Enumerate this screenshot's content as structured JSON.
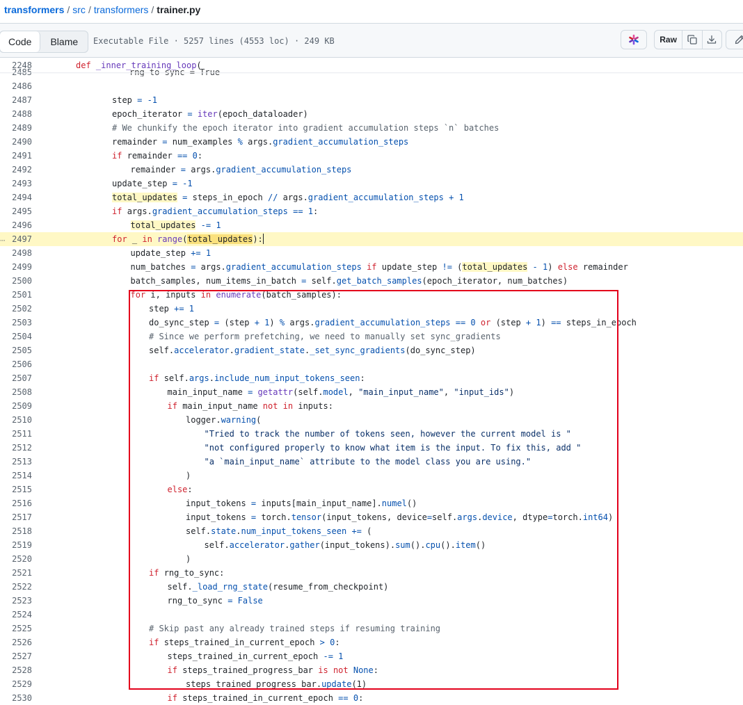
{
  "breadcrumb": {
    "repo": "transformers",
    "sep": "/",
    "dir1": "src",
    "dir2": "transformers",
    "file": "trainer.py"
  },
  "toolbar": {
    "code_label": "Code",
    "blame_label": "Blame",
    "file_info": "Executable File · 5257 lines (4553 loc) · 249 KB",
    "raw_label": "Raw",
    "icons": {
      "copilot": "copilot-icon",
      "copy": "copy-icon",
      "download": "download-icon",
      "edit": "pencil-icon"
    }
  },
  "sticky": {
    "line_number": "2248",
    "kw": "def",
    "fn": "_inner_training_loop",
    "rest": "("
  },
  "ghost": {
    "line_number": "2485",
    "text": "rng_to_sync = True"
  },
  "colors": {
    "keyword": "#cf222e",
    "function": "#6639ba",
    "name": "#0550ae",
    "string": "#0a3069",
    "comment": "#59636e",
    "highlight": "#fff8c5",
    "box": "#e3001b"
  },
  "lines": [
    {
      "n": "2486",
      "i": 0,
      "t": []
    },
    {
      "n": "2487",
      "i": 2,
      "t": [
        [
          "",
          "step "
        ],
        [
          "n",
          "= -1"
        ]
      ]
    },
    {
      "n": "2488",
      "i": 2,
      "t": [
        [
          "",
          "epoch_iterator "
        ],
        [
          "n",
          "= "
        ],
        [
          "f",
          "iter"
        ],
        [
          "",
          "(epoch_dataloader)"
        ]
      ]
    },
    {
      "n": "2489",
      "i": 2,
      "t": [
        [
          "c",
          "# We chunkify the epoch iterator into gradient accumulation steps `n` batches"
        ]
      ]
    },
    {
      "n": "2490",
      "i": 2,
      "t": [
        [
          "",
          "remainder "
        ],
        [
          "n",
          "= "
        ],
        [
          "",
          "num_examples "
        ],
        [
          "n",
          "% "
        ],
        [
          "",
          "args."
        ],
        [
          "n",
          "gradient_accumulation_steps"
        ]
      ]
    },
    {
      "n": "2491",
      "i": 2,
      "t": [
        [
          "k",
          "if "
        ],
        [
          "",
          "remainder "
        ],
        [
          "n",
          "== 0"
        ],
        [
          "",
          ":"
        ]
      ]
    },
    {
      "n": "2492",
      "i": 3,
      "t": [
        [
          "",
          "remainder "
        ],
        [
          "n",
          "= "
        ],
        [
          "",
          "args."
        ],
        [
          "n",
          "gradient_accumulation_steps"
        ]
      ]
    },
    {
      "n": "2493",
      "i": 2,
      "t": [
        [
          "",
          "update_step "
        ],
        [
          "n",
          "= -1"
        ]
      ]
    },
    {
      "n": "2494",
      "i": 2,
      "t": [
        [
          "m",
          "total_updates"
        ],
        [
          "",
          " "
        ],
        [
          "n",
          "= "
        ],
        [
          "",
          "steps_in_epoch "
        ],
        [
          "n",
          "// "
        ],
        [
          "",
          "args."
        ],
        [
          "n",
          "gradient_accumulation_steps + 1"
        ]
      ]
    },
    {
      "n": "2495",
      "i": 2,
      "t": [
        [
          "k",
          "if "
        ],
        [
          "",
          "args."
        ],
        [
          "n",
          "gradient_accumulation_steps == 1"
        ],
        [
          "",
          ":"
        ]
      ]
    },
    {
      "n": "2496",
      "i": 3,
      "t": [
        [
          "m",
          "total_updates"
        ],
        [
          "",
          " "
        ],
        [
          "n",
          "-= 1"
        ]
      ]
    },
    {
      "n": "2497",
      "i": 2,
      "hl": true,
      "cursor": true,
      "t": [
        [
          "k",
          "for "
        ],
        [
          "",
          "_ "
        ],
        [
          "k",
          "in "
        ],
        [
          "f",
          "range"
        ],
        [
          "",
          "("
        ],
        [
          "m",
          "total_updates"
        ],
        [
          "",
          "):"
        ]
      ]
    },
    {
      "n": "2498",
      "i": 3,
      "t": [
        [
          "",
          "update_step "
        ],
        [
          "n",
          "+= 1"
        ]
      ]
    },
    {
      "n": "2499",
      "i": 3,
      "t": [
        [
          "",
          "num_batches "
        ],
        [
          "n",
          "= "
        ],
        [
          "",
          "args."
        ],
        [
          "n",
          "gradient_accumulation_steps "
        ],
        [
          "k",
          "if "
        ],
        [
          "",
          "update_step "
        ],
        [
          "n",
          "!= "
        ],
        [
          "",
          "("
        ],
        [
          "m",
          "total_updates"
        ],
        [
          "",
          " "
        ],
        [
          "n",
          "- 1"
        ],
        [
          "",
          ") "
        ],
        [
          "k",
          "else "
        ],
        [
          "",
          "remainder"
        ]
      ]
    },
    {
      "n": "2500",
      "i": 3,
      "t": [
        [
          "",
          "batch_samples, num_items_in_batch "
        ],
        [
          "n",
          "= "
        ],
        [
          "",
          "self."
        ],
        [
          "n",
          "get_batch_samples"
        ],
        [
          "",
          "(epoch_iterator, num_batches)"
        ]
      ]
    },
    {
      "n": "2501",
      "i": 3,
      "t": [
        [
          "k",
          "for "
        ],
        [
          "",
          "i, inputs "
        ],
        [
          "k",
          "in "
        ],
        [
          "f",
          "enumerate"
        ],
        [
          "",
          "(batch_samples):"
        ]
      ]
    },
    {
      "n": "2502",
      "i": 4,
      "t": [
        [
          "",
          "step "
        ],
        [
          "n",
          "+= 1"
        ]
      ]
    },
    {
      "n": "2503",
      "i": 4,
      "t": [
        [
          "",
          "do_sync_step "
        ],
        [
          "n",
          "= "
        ],
        [
          "",
          "(step "
        ],
        [
          "n",
          "+ 1"
        ],
        [
          "",
          ") "
        ],
        [
          "n",
          "% "
        ],
        [
          "",
          "args."
        ],
        [
          "n",
          "gradient_accumulation_steps == 0 "
        ],
        [
          "k",
          "or "
        ],
        [
          "",
          "(step "
        ],
        [
          "n",
          "+ 1"
        ],
        [
          "",
          ") "
        ],
        [
          "n",
          "== "
        ],
        [
          "",
          "steps_in_epoch"
        ]
      ]
    },
    {
      "n": "2504",
      "i": 4,
      "t": [
        [
          "c",
          "# Since we perform prefetching, we need to manually set sync_gradients"
        ]
      ]
    },
    {
      "n": "2505",
      "i": 4,
      "t": [
        [
          "",
          "self."
        ],
        [
          "n",
          "accelerator"
        ],
        [
          "",
          "."
        ],
        [
          "n",
          "gradient_state"
        ],
        [
          "",
          "."
        ],
        [
          "n",
          "_set_sync_gradients"
        ],
        [
          "",
          "(do_sync_step)"
        ]
      ]
    },
    {
      "n": "2506",
      "i": 0,
      "t": []
    },
    {
      "n": "2507",
      "i": 4,
      "t": [
        [
          "k",
          "if "
        ],
        [
          "",
          "self."
        ],
        [
          "n",
          "args"
        ],
        [
          "",
          "."
        ],
        [
          "n",
          "include_num_input_tokens_seen"
        ],
        [
          "",
          ":"
        ]
      ]
    },
    {
      "n": "2508",
      "i": 5,
      "t": [
        [
          "",
          "main_input_name "
        ],
        [
          "n",
          "= "
        ],
        [
          "f",
          "getattr"
        ],
        [
          "",
          "(self."
        ],
        [
          "n",
          "model"
        ],
        [
          "",
          ", "
        ],
        [
          "s",
          "\"main_input_name\""
        ],
        [
          "",
          ", "
        ],
        [
          "s",
          "\"input_ids\""
        ],
        [
          "",
          ")"
        ]
      ]
    },
    {
      "n": "2509",
      "i": 5,
      "t": [
        [
          "k",
          "if "
        ],
        [
          "",
          "main_input_name "
        ],
        [
          "k",
          "not in "
        ],
        [
          "",
          "inputs:"
        ]
      ]
    },
    {
      "n": "2510",
      "i": 6,
      "t": [
        [
          "",
          "logger."
        ],
        [
          "n",
          "warning"
        ],
        [
          "",
          "("
        ]
      ]
    },
    {
      "n": "2511",
      "i": 7,
      "t": [
        [
          "s",
          "\"Tried to track the number of tokens seen, however the current model is \""
        ]
      ]
    },
    {
      "n": "2512",
      "i": 7,
      "t": [
        [
          "s",
          "\"not configured properly to know what item is the input. To fix this, add \""
        ]
      ]
    },
    {
      "n": "2513",
      "i": 7,
      "t": [
        [
          "s",
          "\"a `main_input_name` attribute to the model class you are using.\""
        ]
      ]
    },
    {
      "n": "2514",
      "i": 6,
      "t": [
        [
          "",
          ")"
        ]
      ]
    },
    {
      "n": "2515",
      "i": 5,
      "t": [
        [
          "k",
          "else"
        ],
        [
          "",
          ":"
        ]
      ]
    },
    {
      "n": "2516",
      "i": 6,
      "t": [
        [
          "",
          "input_tokens "
        ],
        [
          "n",
          "= "
        ],
        [
          "",
          "inputs[main_input_name]."
        ],
        [
          "n",
          "numel"
        ],
        [
          "",
          "()"
        ]
      ]
    },
    {
      "n": "2517",
      "i": 6,
      "t": [
        [
          "",
          "input_tokens "
        ],
        [
          "n",
          "= "
        ],
        [
          "",
          "torch."
        ],
        [
          "n",
          "tensor"
        ],
        [
          "",
          "(input_tokens, device"
        ],
        [
          "n",
          "="
        ],
        [
          "",
          "self."
        ],
        [
          "n",
          "args"
        ],
        [
          "",
          "."
        ],
        [
          "n",
          "device"
        ],
        [
          "",
          ", dtype"
        ],
        [
          "n",
          "="
        ],
        [
          "",
          "torch."
        ],
        [
          "n",
          "int64"
        ],
        [
          "",
          ")"
        ]
      ]
    },
    {
      "n": "2518",
      "i": 6,
      "t": [
        [
          "",
          "self."
        ],
        [
          "n",
          "state"
        ],
        [
          "",
          "."
        ],
        [
          "n",
          "num_input_tokens_seen "
        ],
        [
          "n",
          "+= "
        ],
        [
          "",
          "("
        ]
      ]
    },
    {
      "n": "2519",
      "i": 7,
      "t": [
        [
          "",
          "self."
        ],
        [
          "n",
          "accelerator"
        ],
        [
          "",
          "."
        ],
        [
          "n",
          "gather"
        ],
        [
          "",
          "(input_tokens)."
        ],
        [
          "n",
          "sum"
        ],
        [
          "",
          "()."
        ],
        [
          "n",
          "cpu"
        ],
        [
          "",
          "()."
        ],
        [
          "n",
          "item"
        ],
        [
          "",
          "()"
        ]
      ]
    },
    {
      "n": "2520",
      "i": 6,
      "t": [
        [
          "",
          ")"
        ]
      ]
    },
    {
      "n": "2521",
      "i": 4,
      "t": [
        [
          "k",
          "if "
        ],
        [
          "",
          "rng_to_sync:"
        ]
      ]
    },
    {
      "n": "2522",
      "i": 5,
      "t": [
        [
          "",
          "self."
        ],
        [
          "n",
          "_load_rng_state"
        ],
        [
          "",
          "(resume_from_checkpoint)"
        ]
      ]
    },
    {
      "n": "2523",
      "i": 5,
      "t": [
        [
          "",
          "rng_to_sync "
        ],
        [
          "n",
          "= False"
        ]
      ]
    },
    {
      "n": "2524",
      "i": 0,
      "t": []
    },
    {
      "n": "2525",
      "i": 4,
      "t": [
        [
          "c",
          "# Skip past any already trained steps if resuming training"
        ]
      ]
    },
    {
      "n": "2526",
      "i": 4,
      "t": [
        [
          "k",
          "if "
        ],
        [
          "",
          "steps_trained_in_current_epoch "
        ],
        [
          "n",
          "> 0"
        ],
        [
          "",
          ":"
        ]
      ]
    },
    {
      "n": "2527",
      "i": 5,
      "t": [
        [
          "",
          "steps_trained_in_current_epoch "
        ],
        [
          "n",
          "-= 1"
        ]
      ]
    },
    {
      "n": "2528",
      "i": 5,
      "t": [
        [
          "k",
          "if "
        ],
        [
          "",
          "steps_trained_progress_bar "
        ],
        [
          "k",
          "is not "
        ],
        [
          "n",
          "None"
        ],
        [
          "",
          ":"
        ]
      ]
    },
    {
      "n": "2529",
      "i": 6,
      "t": [
        [
          "",
          "steps_trained_progress_bar."
        ],
        [
          "n",
          "update"
        ],
        [
          "",
          "(1)"
        ]
      ]
    },
    {
      "n": "2530",
      "i": 5,
      "t": [
        [
          "k",
          "if "
        ],
        [
          "",
          "steps_trained_in_current_epoch "
        ],
        [
          "n",
          "== 0"
        ],
        [
          "",
          ":"
        ]
      ]
    }
  ]
}
